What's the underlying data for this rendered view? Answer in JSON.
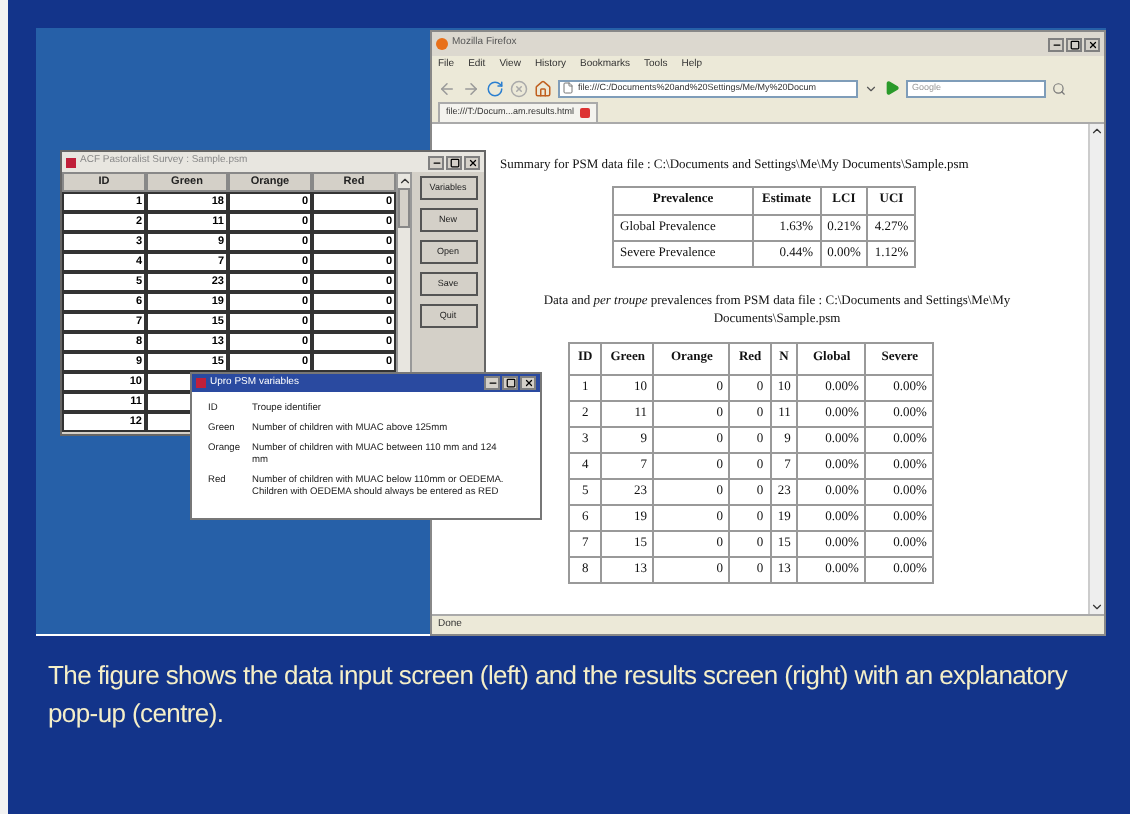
{
  "browser": {
    "title": "Mozilla Firefox",
    "menu": [
      "File",
      "Edit",
      "View",
      "History",
      "Bookmarks",
      "Tools",
      "Help"
    ],
    "url": "file:///C:/Documents%20and%20Settings/Me/My%20Docum",
    "search": {
      "placeholder": "Google"
    },
    "tab": "file:///T:/Docum...am.results.html",
    "summary_heading": "Summary for PSM data file : C:\\Documents and Settings\\Me\\My Documents\\Sample.psm",
    "summary_table": {
      "columns": [
        "Prevalence",
        "Estimate",
        "LCI",
        "UCI"
      ],
      "rows": [
        [
          "Global Prevalence",
          "1.63%",
          "0.21%",
          "4.27%"
        ],
        [
          "Severe Prevalence",
          "0.44%",
          "0.00%",
          "1.12%"
        ]
      ]
    },
    "data_heading": "Data and *per troupe* prevalences from PSM data file : C:\\Documents and Settings\\Me\\My Documents\\Sample.psm",
    "data_table": {
      "columns": [
        "ID",
        "Green",
        "Orange",
        "Red",
        "N",
        "Global",
        "Severe"
      ],
      "rows": [
        [
          "1",
          "10",
          "0",
          "0",
          "10",
          "0.00%",
          "0.00%"
        ],
        [
          "2",
          "11",
          "0",
          "0",
          "11",
          "0.00%",
          "0.00%"
        ],
        [
          "3",
          "9",
          "0",
          "0",
          "9",
          "0.00%",
          "0.00%"
        ],
        [
          "4",
          "7",
          "0",
          "0",
          "7",
          "0.00%",
          "0.00%"
        ],
        [
          "5",
          "23",
          "0",
          "0",
          "23",
          "0.00%",
          "0.00%"
        ],
        [
          "6",
          "19",
          "0",
          "0",
          "19",
          "0.00%",
          "0.00%"
        ],
        [
          "7",
          "15",
          "0",
          "0",
          "15",
          "0.00%",
          "0.00%"
        ],
        [
          "8",
          "13",
          "0",
          "0",
          "13",
          "0.00%",
          "0.00%"
        ]
      ]
    },
    "status": "Done"
  },
  "input_window": {
    "title": "ACF Pastoralist Survey : Sample.psm",
    "columns": [
      "ID",
      "Green",
      "Orange",
      "Red"
    ],
    "rows": [
      [
        "1",
        "18",
        "0",
        "0"
      ],
      [
        "2",
        "11",
        "0",
        "0"
      ],
      [
        "3",
        "9",
        "0",
        "0"
      ],
      [
        "4",
        "7",
        "0",
        "0"
      ],
      [
        "5",
        "23",
        "0",
        "0"
      ],
      [
        "6",
        "19",
        "0",
        "0"
      ],
      [
        "7",
        "15",
        "0",
        "0"
      ],
      [
        "8",
        "13",
        "0",
        "0"
      ],
      [
        "9",
        "15",
        "0",
        "0"
      ],
      [
        "10"
      ],
      [
        "11"
      ],
      [
        "12"
      ]
    ],
    "buttons": [
      "Variables",
      "New",
      "Open",
      "Save",
      "Quit"
    ]
  },
  "popup": {
    "title": "Upro PSM variables",
    "items": [
      {
        "term": "ID",
        "text": "Troupe identifier"
      },
      {
        "term": "Green",
        "text": "Number of children with MUAC above 125mm"
      },
      {
        "term": "Orange",
        "text": "Number of children with MUAC between 110 mm and 124 mm"
      },
      {
        "term": "Red",
        "text": "Number of children with MUAC below 110mm or OEDEMA. Children with OEDEMA should always be entered as RED"
      }
    ]
  },
  "caption": "The figure shows the data input screen (left) and the results screen (right) with an explanatory pop-up (centre)."
}
